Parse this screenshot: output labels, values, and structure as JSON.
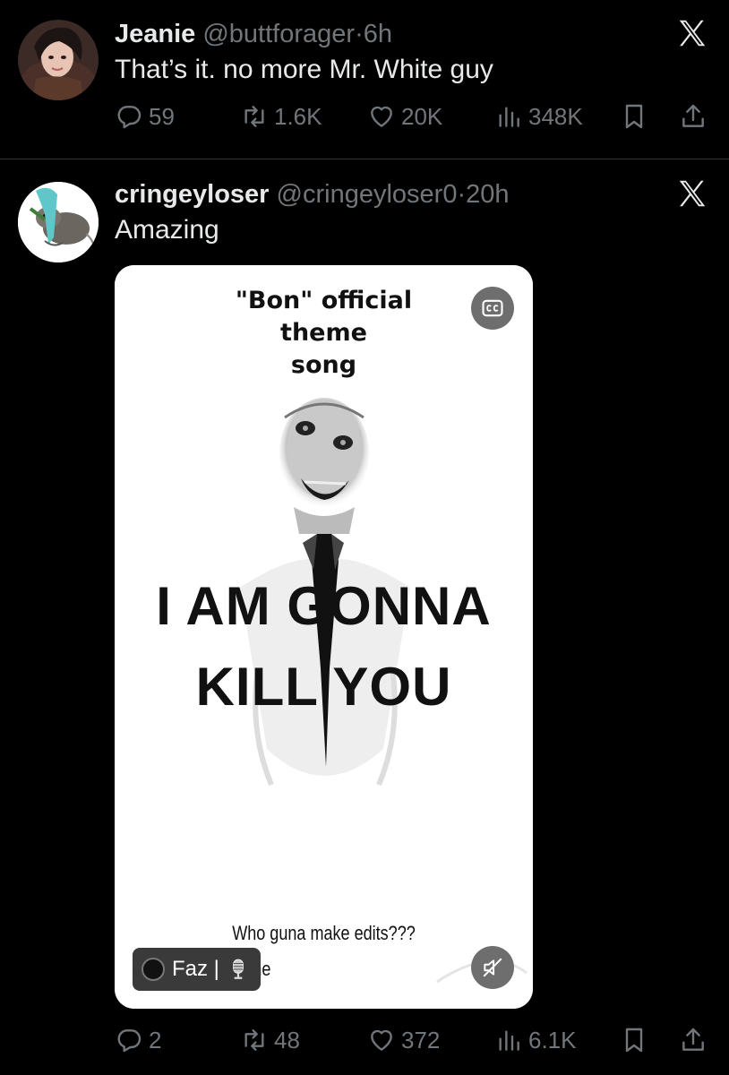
{
  "tweets": [
    {
      "name": "Jeanie",
      "handle": "@buttforager",
      "dot": "·",
      "time": "6h",
      "text": "That’s it. no more Mr. White guy",
      "replies": "59",
      "retweets": "1.6K",
      "likes": "20K",
      "views": "348K"
    },
    {
      "name": "cringeyloser",
      "handle": "@cringeyloser0",
      "dot": "·",
      "time": "20h",
      "text": "Amazing",
      "replies": "2",
      "retweets": "48",
      "likes": "372",
      "views": "6.1K",
      "media": {
        "title_lines": [
          "\"Bon\" official",
          "theme",
          "song"
        ],
        "big_line1": "I AM GONNA",
        "big_line2": "KILL YOU",
        "caption_line1": "Who guna make edits???",
        "caption_line2": "Tag me",
        "badge_label": "Faz |",
        "cc_icon": "closed-captions-icon",
        "mute_icon": "volume-muted-icon"
      }
    }
  ],
  "colors": {
    "background": "#000000",
    "text": "#e7e9ea",
    "secondary": "#71767b",
    "divider": "#2f3336"
  }
}
